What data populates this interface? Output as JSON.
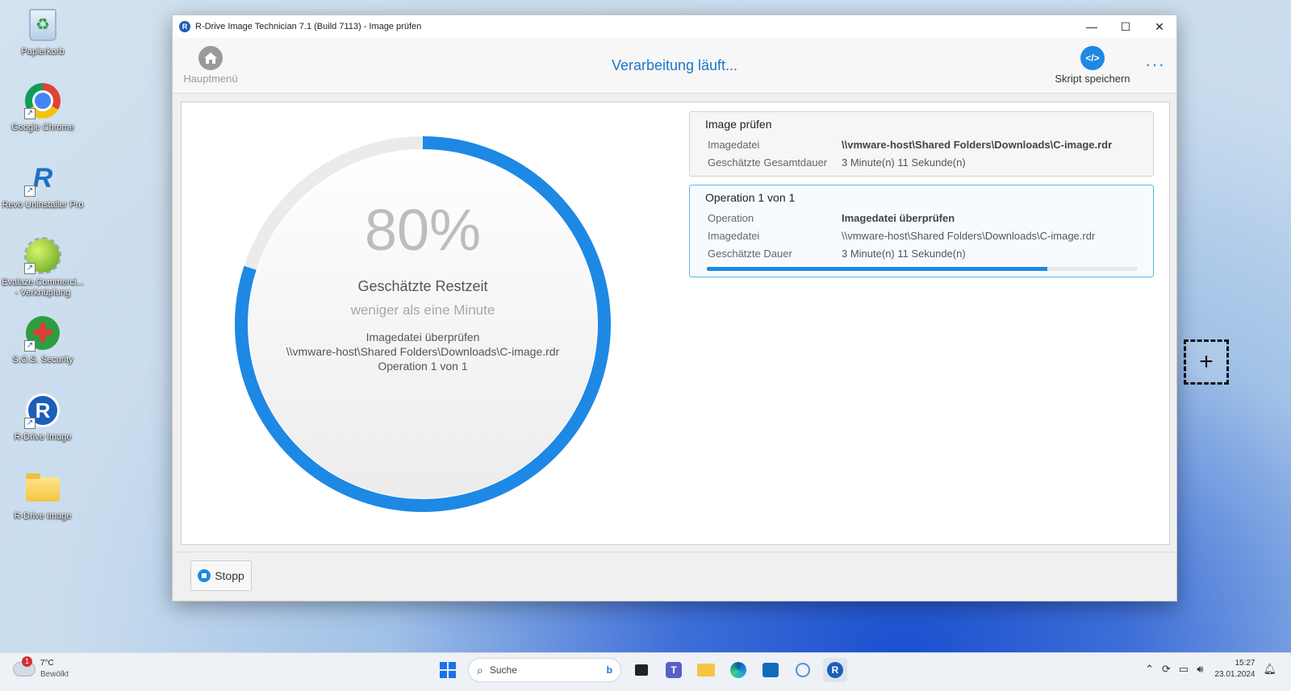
{
  "desktop": {
    "icons": [
      {
        "label": "Papierkorb"
      },
      {
        "label": "Google Chrome"
      },
      {
        "label": "Revo Uninstaller Pro"
      },
      {
        "label": "Evalaze.Commerci... - Verknüpfung"
      },
      {
        "label": "S.O.S. Security"
      },
      {
        "label": "R-Drive Image"
      },
      {
        "label": "R-Drive Image"
      }
    ]
  },
  "window": {
    "title": "R-Drive Image Technician 7.1 (Build 7113) - Image prüfen",
    "toolbar": {
      "home_label": "Hauptmenü",
      "status": "Verarbeitung läuft...",
      "script_label": "Skript speichern",
      "script_icon": "</>",
      "more": "···"
    },
    "progress": {
      "percent_text": "80%",
      "percent_value": 80,
      "remaining_label": "Geschätzte Restzeit",
      "remaining_value": "weniger als eine Minute",
      "info_line1": "Imagedatei überprüfen",
      "info_line2": "\\\\vmware-host\\Shared Folders\\Downloads\\C-image.rdr",
      "info_line3": "Operation 1 von 1",
      "accent": "#1e88e5"
    },
    "summary": {
      "title": "Image prüfen",
      "rows": [
        {
          "key": "Imagedatei",
          "value": "\\\\vmware-host\\Shared Folders\\Downloads\\C-image.rdr"
        },
        {
          "key": "Geschätzte Gesamtdauer",
          "value": "3 Minute(n) 11 Sekunde(n)"
        }
      ]
    },
    "operation": {
      "title": "Operation 1 von 1",
      "rows": [
        {
          "key": "Operation",
          "value": "Imagedatei überprüfen"
        },
        {
          "key": "Imagedatei",
          "value": "\\\\vmware-host\\Shared Folders\\Downloads\\C-image.rdr"
        },
        {
          "key": "Geschätzte Dauer",
          "value": "3 Minute(n) 11 Sekunde(n)"
        }
      ],
      "bar_fraction": 0.79
    },
    "footer": {
      "stop_label": "Stopp"
    }
  },
  "taskbar": {
    "weather_temp": "7°C",
    "weather_desc": "Bewölkt",
    "weather_badge": "1",
    "search_placeholder": "Suche",
    "time": "15:27",
    "date": "23.01.2024"
  }
}
